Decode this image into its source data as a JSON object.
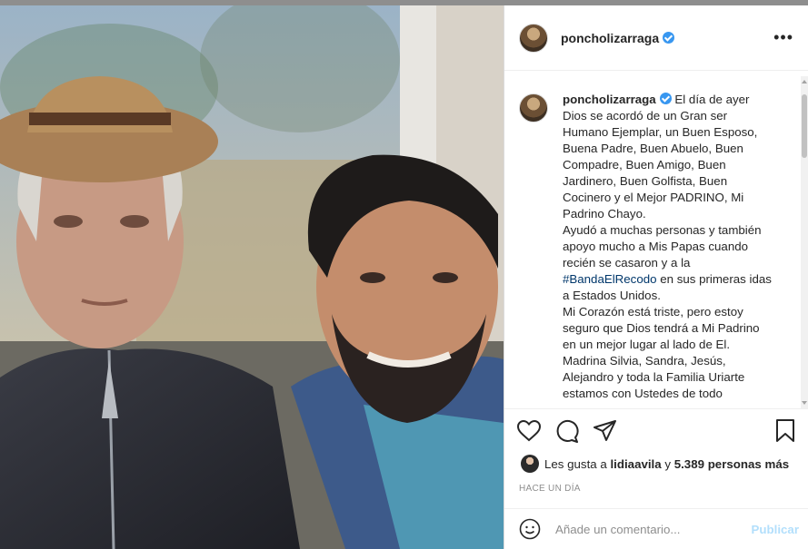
{
  "post": {
    "username": "poncholizarraga",
    "verified": true,
    "photo_alt": "Dos hombres posando juntos"
  },
  "caption": {
    "username": "poncholizarraga",
    "text_1": "El día de ayer Dios se acordó de un Gran ser Humano Ejemplar, un Buen Esposo, Buena Padre, Buen Abuelo, Buen Compadre, Buen Amigo, Buen Jardinero, Buen Golfista, Buen Cocinero y el Mejor PADRINO, Mi Padrino Chayo.",
    "text_2": "Ayudó a muchas personas y también apoyo mucho a Mis Papas cuando recién se casaron y a la",
    "hashtag": "#BandaElRecodo",
    "text_3": "en sus primeras idas a Estados Unidos.",
    "text_4": "Mi Corazón está triste, pero estoy seguro que Dios tendrá a Mi Padrino en un mejor lugar al lado de El. Madrina Silvia, Sandra, Jesús, Alejandro y toda la Familia Uriarte estamos con Ustedes de todo"
  },
  "likes": {
    "prefix": "Les gusta a",
    "user": "lidiaavila",
    "joiner": "y",
    "others": "5.389 personas más"
  },
  "timestamp": "HACE UN DÍA",
  "comment": {
    "placeholder": "Añade un comentario...",
    "post_label": "Publicar"
  },
  "colors": {
    "link": "#00376b",
    "verified": "#3897f0",
    "post_disabled": "#b2dffc"
  }
}
